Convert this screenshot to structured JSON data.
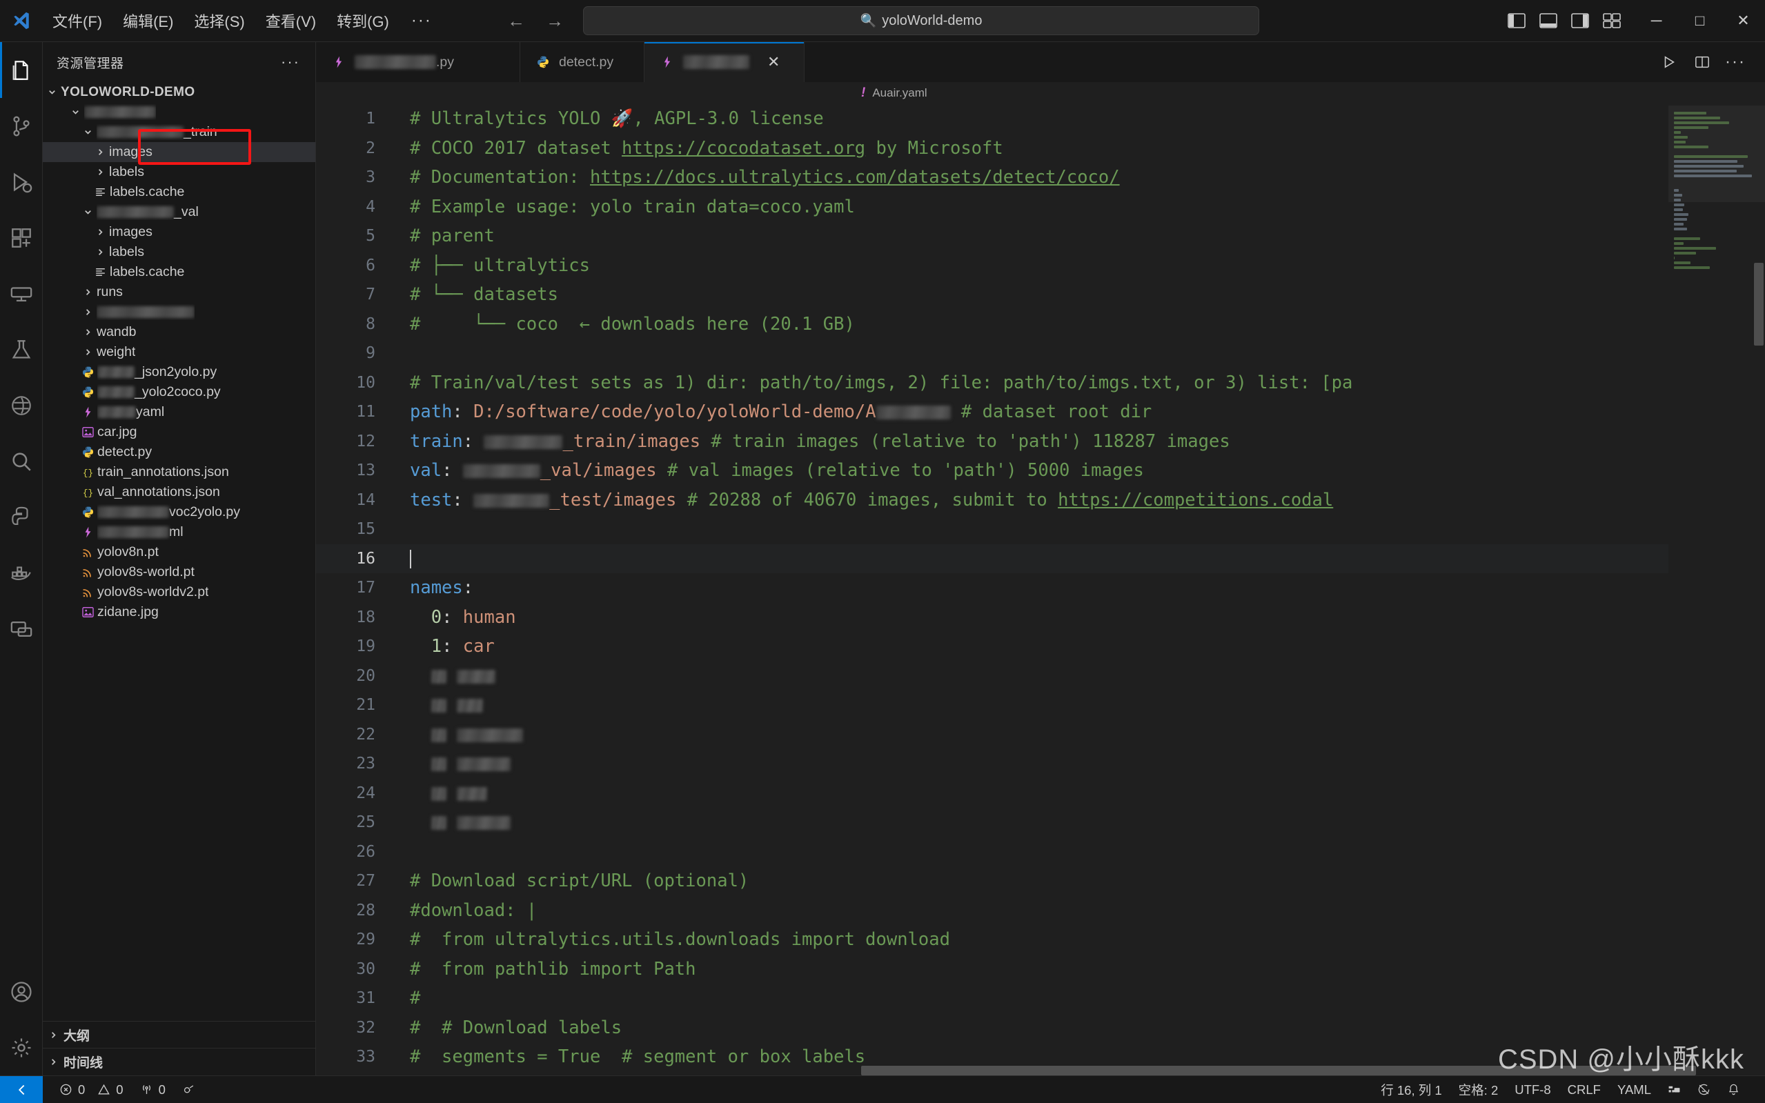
{
  "titlebar": {
    "menu": [
      "文件(F)",
      "编辑(E)",
      "选择(S)",
      "查看(V)",
      "转到(G)"
    ],
    "menu_more": "···",
    "back_icon": "←",
    "forward_icon": "→",
    "search_placeholder": "yoloWorld-demo",
    "search_value": "yoloWorld-demo",
    "minimize": "─",
    "maximize": "□",
    "close": "✕"
  },
  "activity_bar": {
    "items": [
      {
        "name": "explorer",
        "active": true
      },
      {
        "name": "source-control",
        "active": false
      },
      {
        "name": "run-and-debug",
        "active": false
      },
      {
        "name": "extensions",
        "active": false
      },
      {
        "name": "remote-explorer",
        "active": false
      },
      {
        "name": "testing",
        "active": false
      },
      {
        "name": "copilot-chat",
        "active": false
      },
      {
        "name": "search",
        "active": false
      },
      {
        "name": "python-env",
        "active": false
      },
      {
        "name": "docker",
        "active": false
      },
      {
        "name": "live-share",
        "active": false
      }
    ],
    "bottom": [
      {
        "name": "accounts"
      },
      {
        "name": "settings"
      }
    ]
  },
  "sidebar": {
    "title": "资源管理器",
    "more_label": "···",
    "root": "YOLOWORLD-DEMO",
    "tree": [
      {
        "label": "",
        "blur_width": 104,
        "depth": 1,
        "type": "folder",
        "expanded": true
      },
      {
        "label": "_train",
        "blur_width": 126,
        "depth": 2,
        "type": "folder",
        "expanded": true
      },
      {
        "label": "images",
        "blur_width": 0,
        "depth": 3,
        "type": "folder",
        "expanded": false,
        "selected": true,
        "boxed": true
      },
      {
        "label": "labels",
        "blur_width": 0,
        "depth": 3,
        "type": "folder",
        "expanded": false,
        "boxed": true
      },
      {
        "label": "labels.cache",
        "blur_width": 0,
        "depth": 3,
        "type": "file",
        "icon": "cache-icon"
      },
      {
        "label": "_val",
        "blur_width": 112,
        "depth": 2,
        "type": "folder",
        "expanded": true
      },
      {
        "label": "images",
        "blur_width": 0,
        "depth": 3,
        "type": "folder",
        "expanded": false
      },
      {
        "label": "labels",
        "blur_width": 0,
        "depth": 3,
        "type": "folder",
        "expanded": false
      },
      {
        "label": "labels.cache",
        "blur_width": 0,
        "depth": 3,
        "type": "file",
        "icon": "cache-icon"
      },
      {
        "label": "runs",
        "blur_width": 0,
        "depth": 2,
        "type": "folder",
        "expanded": false
      },
      {
        "label": "",
        "blur_width": 142,
        "depth": 2,
        "type": "folder",
        "expanded": false
      },
      {
        "label": "wandb",
        "blur_width": 0,
        "depth": 2,
        "type": "folder",
        "expanded": false
      },
      {
        "label": "weight",
        "blur_width": 0,
        "depth": 2,
        "type": "folder",
        "expanded": false
      },
      {
        "label": "_json2yolo.py",
        "blur_width": 54,
        "depth": 2,
        "type": "file",
        "icon": "python-icon"
      },
      {
        "label": "_yolo2coco.py",
        "blur_width": 54,
        "depth": 2,
        "type": "file",
        "icon": "python-icon"
      },
      {
        "label": "yaml",
        "blur_width": 56,
        "depth": 2,
        "type": "file",
        "icon": "yaml-icon"
      },
      {
        "label": "car.jpg",
        "blur_width": 0,
        "depth": 2,
        "type": "file",
        "icon": "image-icon"
      },
      {
        "label": "detect.py",
        "blur_width": 0,
        "depth": 2,
        "type": "file",
        "icon": "python-icon"
      },
      {
        "label": "train_annotations.json",
        "blur_width": 0,
        "depth": 2,
        "type": "file",
        "icon": "json-icon"
      },
      {
        "label": "val_annotations.json",
        "blur_width": 0,
        "depth": 2,
        "type": "file",
        "icon": "json-icon"
      },
      {
        "label": "voc2yolo.py",
        "blur_width": 104,
        "depth": 2,
        "type": "file",
        "icon": "python-icon"
      },
      {
        "label": "ml",
        "blur_width": 104,
        "depth": 2,
        "type": "file",
        "icon": "yaml-icon"
      },
      {
        "label": "yolov8n.pt",
        "blur_width": 0,
        "depth": 2,
        "type": "file",
        "icon": "pt-icon"
      },
      {
        "label": "yolov8s-world.pt",
        "blur_width": 0,
        "depth": 2,
        "type": "file",
        "icon": "pt-icon"
      },
      {
        "label": "yolov8s-worldv2.pt",
        "blur_width": 0,
        "depth": 2,
        "type": "file",
        "icon": "pt-icon"
      },
      {
        "label": "zidane.jpg",
        "blur_width": 0,
        "depth": 2,
        "type": "file",
        "icon": "image-icon"
      }
    ],
    "sections": [
      {
        "label": "大纲"
      },
      {
        "label": "时间线"
      }
    ]
  },
  "editor": {
    "tabs": [
      {
        "label": ".py",
        "blur_width": 118,
        "icon": "yaml-icon",
        "active": false,
        "dirty": false
      },
      {
        "label": "detect.py",
        "blur_width": 0,
        "icon": "python-icon",
        "active": false,
        "dirty": false
      },
      {
        "label": "",
        "blur_width": 96,
        "icon": "yaml-icon",
        "active": true,
        "close": "✕"
      }
    ],
    "toolbar": {
      "run": "▷",
      "split": "split-editor",
      "more": "···"
    },
    "breadcrumb": {
      "icon": "!",
      "text": "Auair.yaml"
    },
    "code_lines": [
      {
        "n": 1,
        "tokens": [
          {
            "t": "# Ultralytics YOLO 🚀, AGPL-3.0 license",
            "c": "c-com"
          }
        ]
      },
      {
        "n": 2,
        "tokens": [
          {
            "t": "# COCO 2017 dataset ",
            "c": "c-com"
          },
          {
            "t": "https://cocodataset.org",
            "c": "c-lnk"
          },
          {
            "t": " by Microsoft",
            "c": "c-com"
          }
        ]
      },
      {
        "n": 3,
        "tokens": [
          {
            "t": "# Documentation: ",
            "c": "c-com"
          },
          {
            "t": "https://docs.ultralytics.com/datasets/detect/coco/",
            "c": "c-lnk"
          }
        ]
      },
      {
        "n": 4,
        "tokens": [
          {
            "t": "# Example usage: yolo train data=coco.yaml",
            "c": "c-com"
          }
        ]
      },
      {
        "n": 5,
        "tokens": [
          {
            "t": "# parent",
            "c": "c-com"
          }
        ]
      },
      {
        "n": 6,
        "tokens": [
          {
            "t": "# ├── ultralytics",
            "c": "c-com"
          }
        ]
      },
      {
        "n": 7,
        "tokens": [
          {
            "t": "# └── datasets",
            "c": "c-com"
          }
        ]
      },
      {
        "n": 8,
        "tokens": [
          {
            "t": "#     └── coco  ← downloads here (20.1 GB)",
            "c": "c-com"
          }
        ]
      },
      {
        "n": 9,
        "tokens": []
      },
      {
        "n": 10,
        "tokens": [
          {
            "t": "# Train/val/test sets as 1) dir: path/to/imgs, 2) file: path/to/imgs.txt, or 3) list: [pa",
            "c": "c-com"
          }
        ]
      },
      {
        "n": 11,
        "tokens": [
          {
            "t": "path",
            "c": "c-key"
          },
          {
            "t": ": ",
            "c": "c-plain"
          },
          {
            "t": "D:/software/code/yolo/yoloWorld-demo/",
            "c": "c-str"
          },
          {
            "t": "A",
            "c": "c-str"
          },
          {
            "b": 108,
            "c": "c-str"
          },
          {
            "t": " ",
            "c": "c-plain"
          },
          {
            "t": "# dataset root dir",
            "c": "c-com"
          }
        ]
      },
      {
        "n": 12,
        "tokens": [
          {
            "t": "train",
            "c": "c-key"
          },
          {
            "t": ": ",
            "c": "c-plain"
          },
          {
            "b": 114,
            "c": "c-str"
          },
          {
            "t": "_train/images ",
            "c": "c-str"
          },
          {
            "t": "# train images (relative to 'path') 118287 images",
            "c": "c-com"
          }
        ]
      },
      {
        "n": 13,
        "tokens": [
          {
            "t": "val",
            "c": "c-key"
          },
          {
            "t": ": ",
            "c": "c-plain"
          },
          {
            "b": 112,
            "c": "c-str"
          },
          {
            "t": "_val/images ",
            "c": "c-str"
          },
          {
            "t": "# val images (relative to 'path') 5000 images",
            "c": "c-com"
          }
        ]
      },
      {
        "n": 14,
        "tokens": [
          {
            "t": "test",
            "c": "c-key"
          },
          {
            "t": ": ",
            "c": "c-plain"
          },
          {
            "b": 110,
            "c": "c-str"
          },
          {
            "t": "_test/images ",
            "c": "c-str"
          },
          {
            "t": "# 20288 of 40670 images, submit to ",
            "c": "c-com"
          },
          {
            "t": "https://competitions.codal",
            "c": "c-lnk"
          }
        ]
      },
      {
        "n": 15,
        "tokens": []
      },
      {
        "n": 16,
        "tokens": [],
        "current": true
      },
      {
        "n": 17,
        "tokens": [
          {
            "t": "names",
            "c": "c-key"
          },
          {
            "t": ":",
            "c": "c-plain"
          }
        ]
      },
      {
        "n": 18,
        "tokens": [
          {
            "t": "  ",
            "c": "c-plain"
          },
          {
            "t": "0",
            "c": "c-num"
          },
          {
            "t": ": ",
            "c": "c-plain"
          },
          {
            "t": "human",
            "c": "c-str"
          }
        ]
      },
      {
        "n": 19,
        "tokens": [
          {
            "t": "  ",
            "c": "c-plain"
          },
          {
            "t": "1",
            "c": "c-num"
          },
          {
            "t": ": ",
            "c": "c-plain"
          },
          {
            "t": "car",
            "c": "c-str"
          }
        ]
      },
      {
        "n": 20,
        "tokens": [
          {
            "t": "  ",
            "c": "c-plain"
          },
          {
            "b": 22,
            "c": "c-num"
          },
          {
            "t": " ",
            "c": "c-plain"
          },
          {
            "b": 56,
            "c": "c-str"
          }
        ]
      },
      {
        "n": 21,
        "tokens": [
          {
            "t": "  ",
            "c": "c-plain"
          },
          {
            "b": 22,
            "c": "c-num"
          },
          {
            "t": " ",
            "c": "c-plain"
          },
          {
            "b": 38,
            "c": "c-str"
          }
        ]
      },
      {
        "n": 22,
        "tokens": [
          {
            "t": "  ",
            "c": "c-plain"
          },
          {
            "b": 22,
            "c": "c-num"
          },
          {
            "t": " ",
            "c": "c-plain"
          },
          {
            "b": 96,
            "c": "c-str"
          }
        ]
      },
      {
        "n": 23,
        "tokens": [
          {
            "t": "  ",
            "c": "c-plain"
          },
          {
            "b": 22,
            "c": "c-num"
          },
          {
            "t": " ",
            "c": "c-plain"
          },
          {
            "b": 78,
            "c": "c-str"
          }
        ]
      },
      {
        "n": 24,
        "tokens": [
          {
            "t": "  ",
            "c": "c-plain"
          },
          {
            "b": 22,
            "c": "c-num"
          },
          {
            "t": " ",
            "c": "c-plain"
          },
          {
            "b": 44,
            "c": "c-str"
          }
        ]
      },
      {
        "n": 25,
        "tokens": [
          {
            "t": "  ",
            "c": "c-plain"
          },
          {
            "b": 22,
            "c": "c-num"
          },
          {
            "t": " ",
            "c": "c-plain"
          },
          {
            "b": 78,
            "c": "c-str"
          }
        ]
      },
      {
        "n": 26,
        "tokens": []
      },
      {
        "n": 27,
        "tokens": [
          {
            "t": "# Download script/URL (optional)",
            "c": "c-com"
          }
        ]
      },
      {
        "n": 28,
        "tokens": [
          {
            "t": "#download: |",
            "c": "c-com"
          }
        ]
      },
      {
        "n": 29,
        "tokens": [
          {
            "t": "#  from ultralytics.utils.downloads import download",
            "c": "c-com"
          }
        ]
      },
      {
        "n": 30,
        "tokens": [
          {
            "t": "#  from pathlib import Path",
            "c": "c-com"
          }
        ]
      },
      {
        "n": 31,
        "tokens": [
          {
            "t": "#",
            "c": "c-com"
          }
        ]
      },
      {
        "n": 32,
        "tokens": [
          {
            "t": "#  # Download labels",
            "c": "c-com"
          }
        ]
      },
      {
        "n": 33,
        "tokens": [
          {
            "t": "#  segments = True  # segment or box labels",
            "c": "c-com"
          }
        ]
      }
    ]
  },
  "statusbar": {
    "remote_icon": "remote-window-icon",
    "errors": "0",
    "warnings": "0",
    "ports": "0",
    "debug_icon": "debug-icon",
    "position": "行 16, 列 1",
    "spaces": "空格: 2",
    "encoding": "UTF-8",
    "eol": "CRLF",
    "language": "YAML",
    "layout_icon": "editor-layout-icon",
    "bell_icon": "bell-icon",
    "feedback_icon": "feedback-icon"
  },
  "watermark": "CSDN @小小酥kkk"
}
